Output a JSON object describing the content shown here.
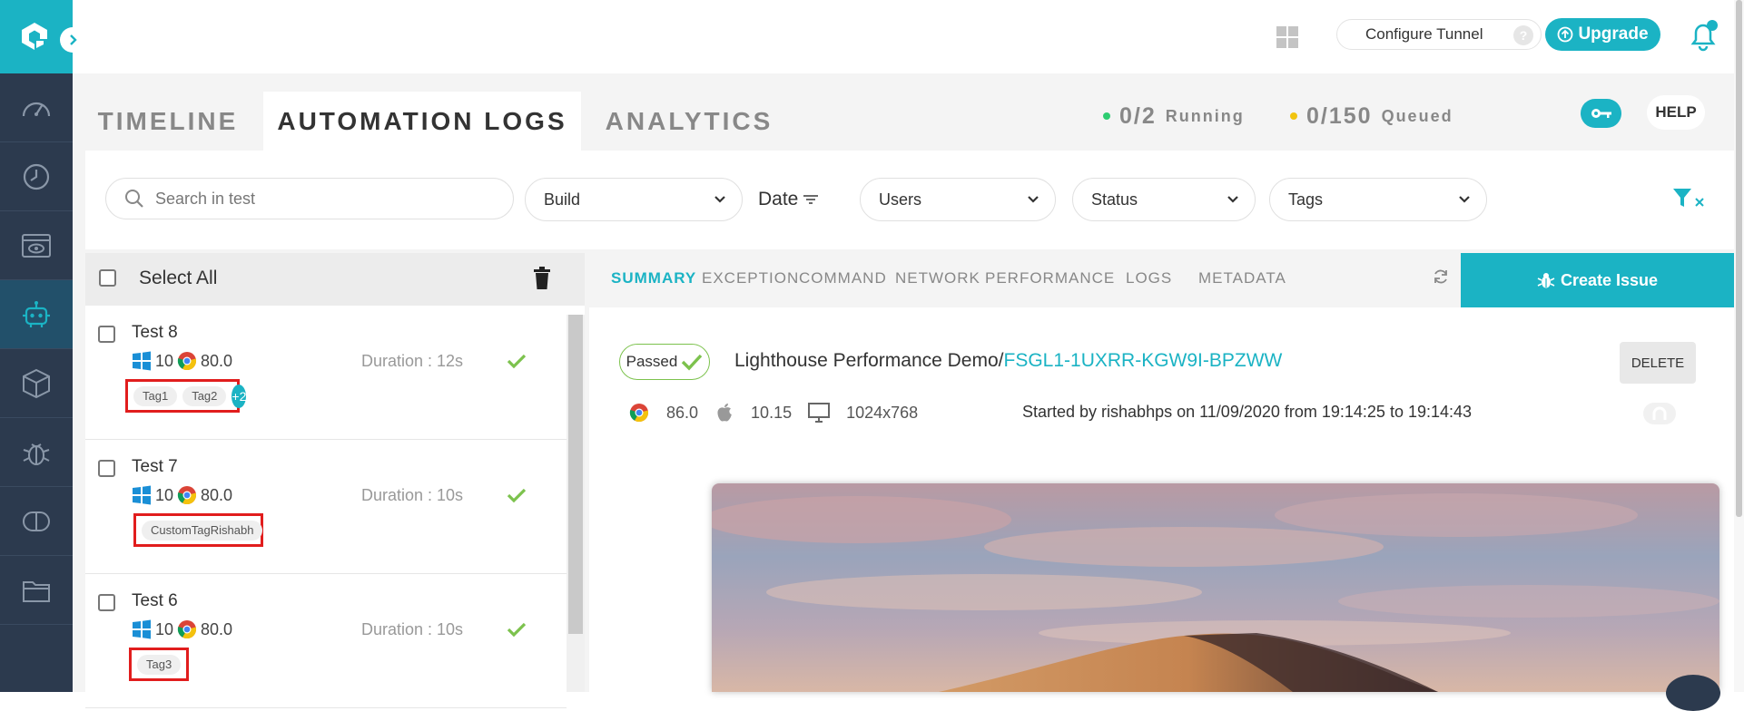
{
  "topbar": {
    "configure_tunnel": "Configure Tunnel",
    "tunnel_help": "?",
    "upgrade": "Upgrade"
  },
  "tabs": [
    {
      "label": "TIMELINE",
      "active": false
    },
    {
      "label": "AUTOMATION LOGS",
      "active": true
    },
    {
      "label": "ANALYTICS",
      "active": false
    }
  ],
  "stats": {
    "running_count": "0/2",
    "running_label": "Running",
    "running_color": "#2ecc71",
    "queued_count": "0/150",
    "queued_label": "Queued",
    "queued_color": "#f1c40f"
  },
  "help_label": "HELP",
  "filters": {
    "search_placeholder": "Search in test",
    "build": "Build",
    "date": "Date",
    "users": "Users",
    "status": "Status",
    "tags": "Tags"
  },
  "list": {
    "select_all": "Select All",
    "tests": [
      {
        "name": "Test 8",
        "os_version": "10",
        "browser_version": "80.0",
        "duration": "Duration : 12s",
        "tags": [
          "Tag1",
          "Tag2"
        ],
        "more": "+2"
      },
      {
        "name": "Test 7",
        "os_version": "10",
        "browser_version": "80.0",
        "duration": "Duration : 10s",
        "tags": [
          "CustomTagRishabh"
        ]
      },
      {
        "name": "Test 6",
        "os_version": "10",
        "browser_version": "80.0",
        "duration": "Duration : 10s",
        "tags": [
          "Tag3"
        ]
      }
    ]
  },
  "detail": {
    "tabs": [
      "SUMMARY",
      "EXCEPTION",
      "COMMAND",
      "NETWORK",
      "PERFORMANCE",
      "LOGS",
      "METADATA"
    ],
    "active_tab": "SUMMARY",
    "create_issue": "Create Issue",
    "status": "Passed",
    "build_name": "Lighthouse Performance Demo/",
    "test_id": "FSGL1-1UXRR-KGW9I-BPZWW",
    "delete": "DELETE",
    "browser_version": "86.0",
    "os_version": "10.15",
    "resolution": "1024x768",
    "started_by": "Started by rishabhps on 11/09/2020 from 19:14:25 to 19:14:43"
  },
  "colors": {
    "accent": "#1bb3c4",
    "rail": "#2c3a4e",
    "tag_highlight": "#e11d1d",
    "pass": "#7cc24d"
  }
}
